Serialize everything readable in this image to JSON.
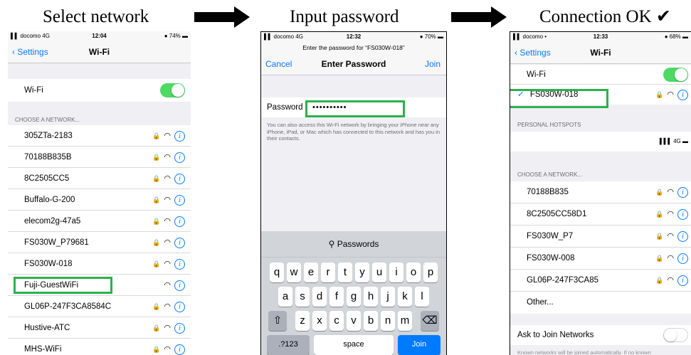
{
  "captions": {
    "step1": "Select network",
    "step2": "Input password",
    "step3": "Connection OK ✔"
  },
  "screen1": {
    "status": {
      "carrier": "▌▌ docomo  4G",
      "time": "12:04",
      "battery": "● 74% ▬"
    },
    "nav": {
      "back": "‹ Settings",
      "title": "Wi-Fi"
    },
    "wifi_label": "Wi-Fi",
    "wifi_on": true,
    "section": "CHOOSE A NETWORK...",
    "networks": [
      {
        "name": "305ZTa-2183",
        "locked": true
      },
      {
        "name": "70188B835B",
        "locked": true
      },
      {
        "name": "8C2505CC5",
        "locked": true
      },
      {
        "name": "Buffalo-G-200",
        "locked": true
      },
      {
        "name": "elecom2g-47a5",
        "locked": true
      },
      {
        "name": "FS030W_P79681",
        "locked": true
      },
      {
        "name": "FS030W-018",
        "locked": true
      },
      {
        "name": "Fuji-GuestWiFi",
        "locked": false
      },
      {
        "name": "GL06P-247F3CA8584C",
        "locked": true
      },
      {
        "name": "Hustive-ATC",
        "locked": true
      },
      {
        "name": "MHS-WiFi",
        "locked": true
      }
    ]
  },
  "screen2": {
    "status": {
      "carrier": "▌▌ docomo  4G",
      "time": "12:32",
      "battery": "● 70% ▬"
    },
    "prompt": "Enter the password for “FS030W-018”",
    "nav": {
      "cancel": "Cancel",
      "title": "Enter Password",
      "join": "Join"
    },
    "password_label": "Password",
    "password_value": "••••••••••",
    "hint": "You can also access this Wi-Fi network by bringing your iPhone near any iPhone, iPad, or Mac which has connected to this network and has you in their contacts.",
    "keyboard": {
      "suggestion": "Passwords",
      "row1": [
        "q",
        "w",
        "e",
        "r",
        "t",
        "y",
        "u",
        "i",
        "o",
        "p"
      ],
      "row2": [
        "a",
        "s",
        "d",
        "f",
        "g",
        "h",
        "j",
        "k",
        "l"
      ],
      "row3": [
        "z",
        "x",
        "c",
        "v",
        "b",
        "n",
        "m"
      ],
      "shift": "⇧",
      "delete": "⌫",
      "numbers": ".?123",
      "space": "space",
      "join": "Join"
    }
  },
  "screen3": {
    "status": {
      "carrier": "▌▌ docomo  •",
      "time": "12:33",
      "battery": "● 68% ▬"
    },
    "nav": {
      "back": "‹ Settings",
      "title": "Wi-Fi"
    },
    "wifi_label": "Wi-Fi",
    "connected_check": "✓",
    "connected_network": "FS030W-018",
    "hotspots_section": "PERSONAL HOTSPOTS",
    "hotspot_signal": "▌▌▌ 4G ▬",
    "section": "CHOOSE A NETWORK...",
    "networks": [
      {
        "name": "70188B835",
        "locked": true
      },
      {
        "name": "8C2505CC58D1",
        "locked": true
      },
      {
        "name": "FS030W_P7",
        "locked": true
      },
      {
        "name": "FS030W-008",
        "locked": true
      },
      {
        "name": "GL06P-247F3CA85",
        "locked": true
      }
    ],
    "other": "Other...",
    "ask_label": "Ask to Join Networks",
    "ask_on": false,
    "footnote": "Known networks will be joined automatically. If no known"
  },
  "icons": {
    "lock": "🔒",
    "wifi": "◠",
    "info": "i"
  },
  "colors": {
    "accent": "#007aff",
    "toggle_on": "#4cd964",
    "highlight": "#2bb24c"
  }
}
